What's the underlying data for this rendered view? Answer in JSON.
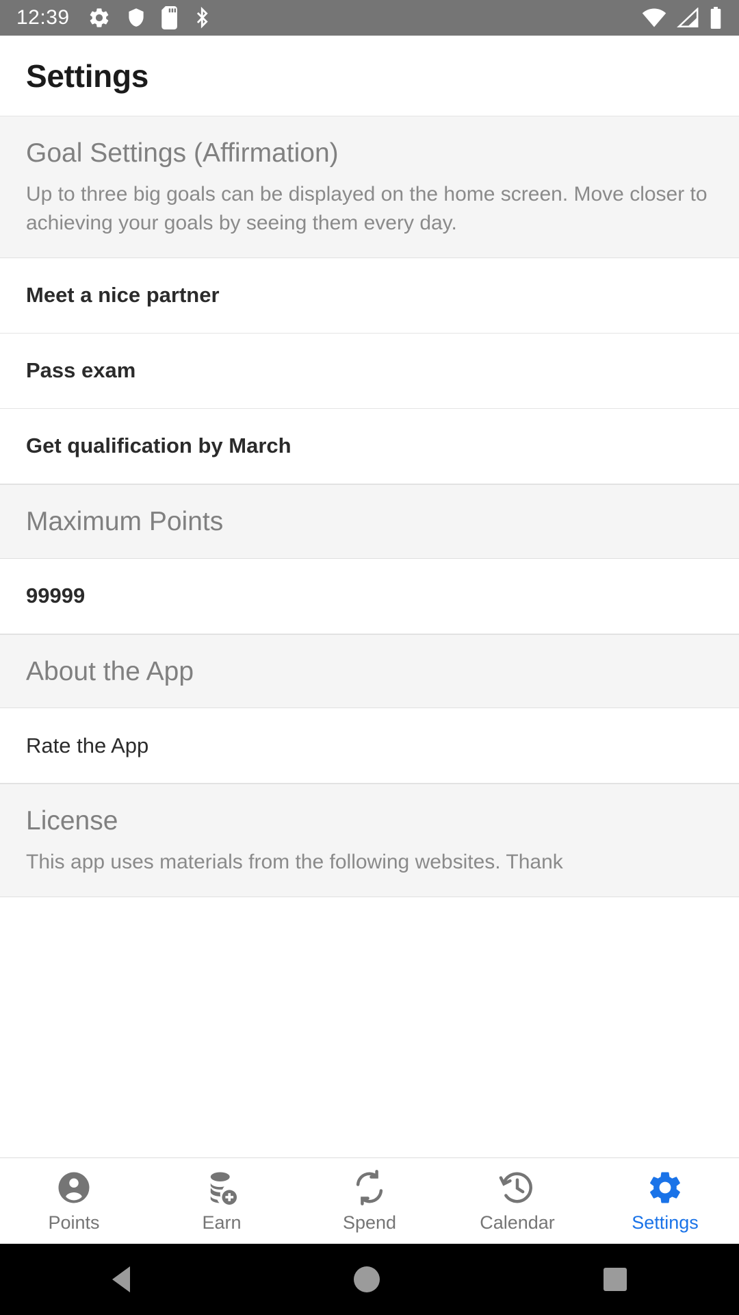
{
  "status_bar": {
    "time": "12:39",
    "left_icons": [
      "gear-icon",
      "shield-icon",
      "sd-card-icon",
      "bluetooth-icon"
    ],
    "right_icons": [
      "wifi-icon",
      "cellular-signal-icon",
      "battery-icon"
    ],
    "background_color": "#757575",
    "foreground_color": "#ffffff"
  },
  "app_bar": {
    "title": "Settings"
  },
  "sections": {
    "goal": {
      "title": "Goal Settings (Affirmation)",
      "description": "Up to three big goals can be displayed on the home screen. Move closer to achieving your goals by seeing them every day.",
      "items": [
        {
          "label": "Meet a nice partner"
        },
        {
          "label": "Pass exam"
        },
        {
          "label": "Get qualification by March"
        }
      ]
    },
    "max_points": {
      "title": "Maximum Points",
      "value": "99999"
    },
    "about": {
      "title": "About the App",
      "items": [
        {
          "label": "Rate the App"
        }
      ]
    },
    "license": {
      "title": "License",
      "description": "This app uses materials from the following websites. Thank"
    }
  },
  "bottom_nav": {
    "active_color": "#1a73e8",
    "inactive_color": "#757575",
    "items": [
      {
        "label": "Points",
        "icon": "person-icon",
        "active": false
      },
      {
        "label": "Earn",
        "icon": "coins-add-icon",
        "active": false
      },
      {
        "label": "Spend",
        "icon": "sync-arrows-icon",
        "active": false
      },
      {
        "label": "Calendar",
        "icon": "history-clock-icon",
        "active": false
      },
      {
        "label": "Settings",
        "icon": "gear-icon",
        "active": true
      }
    ]
  },
  "system_nav": {
    "buttons": [
      "back-button",
      "home-button",
      "recents-button"
    ]
  }
}
